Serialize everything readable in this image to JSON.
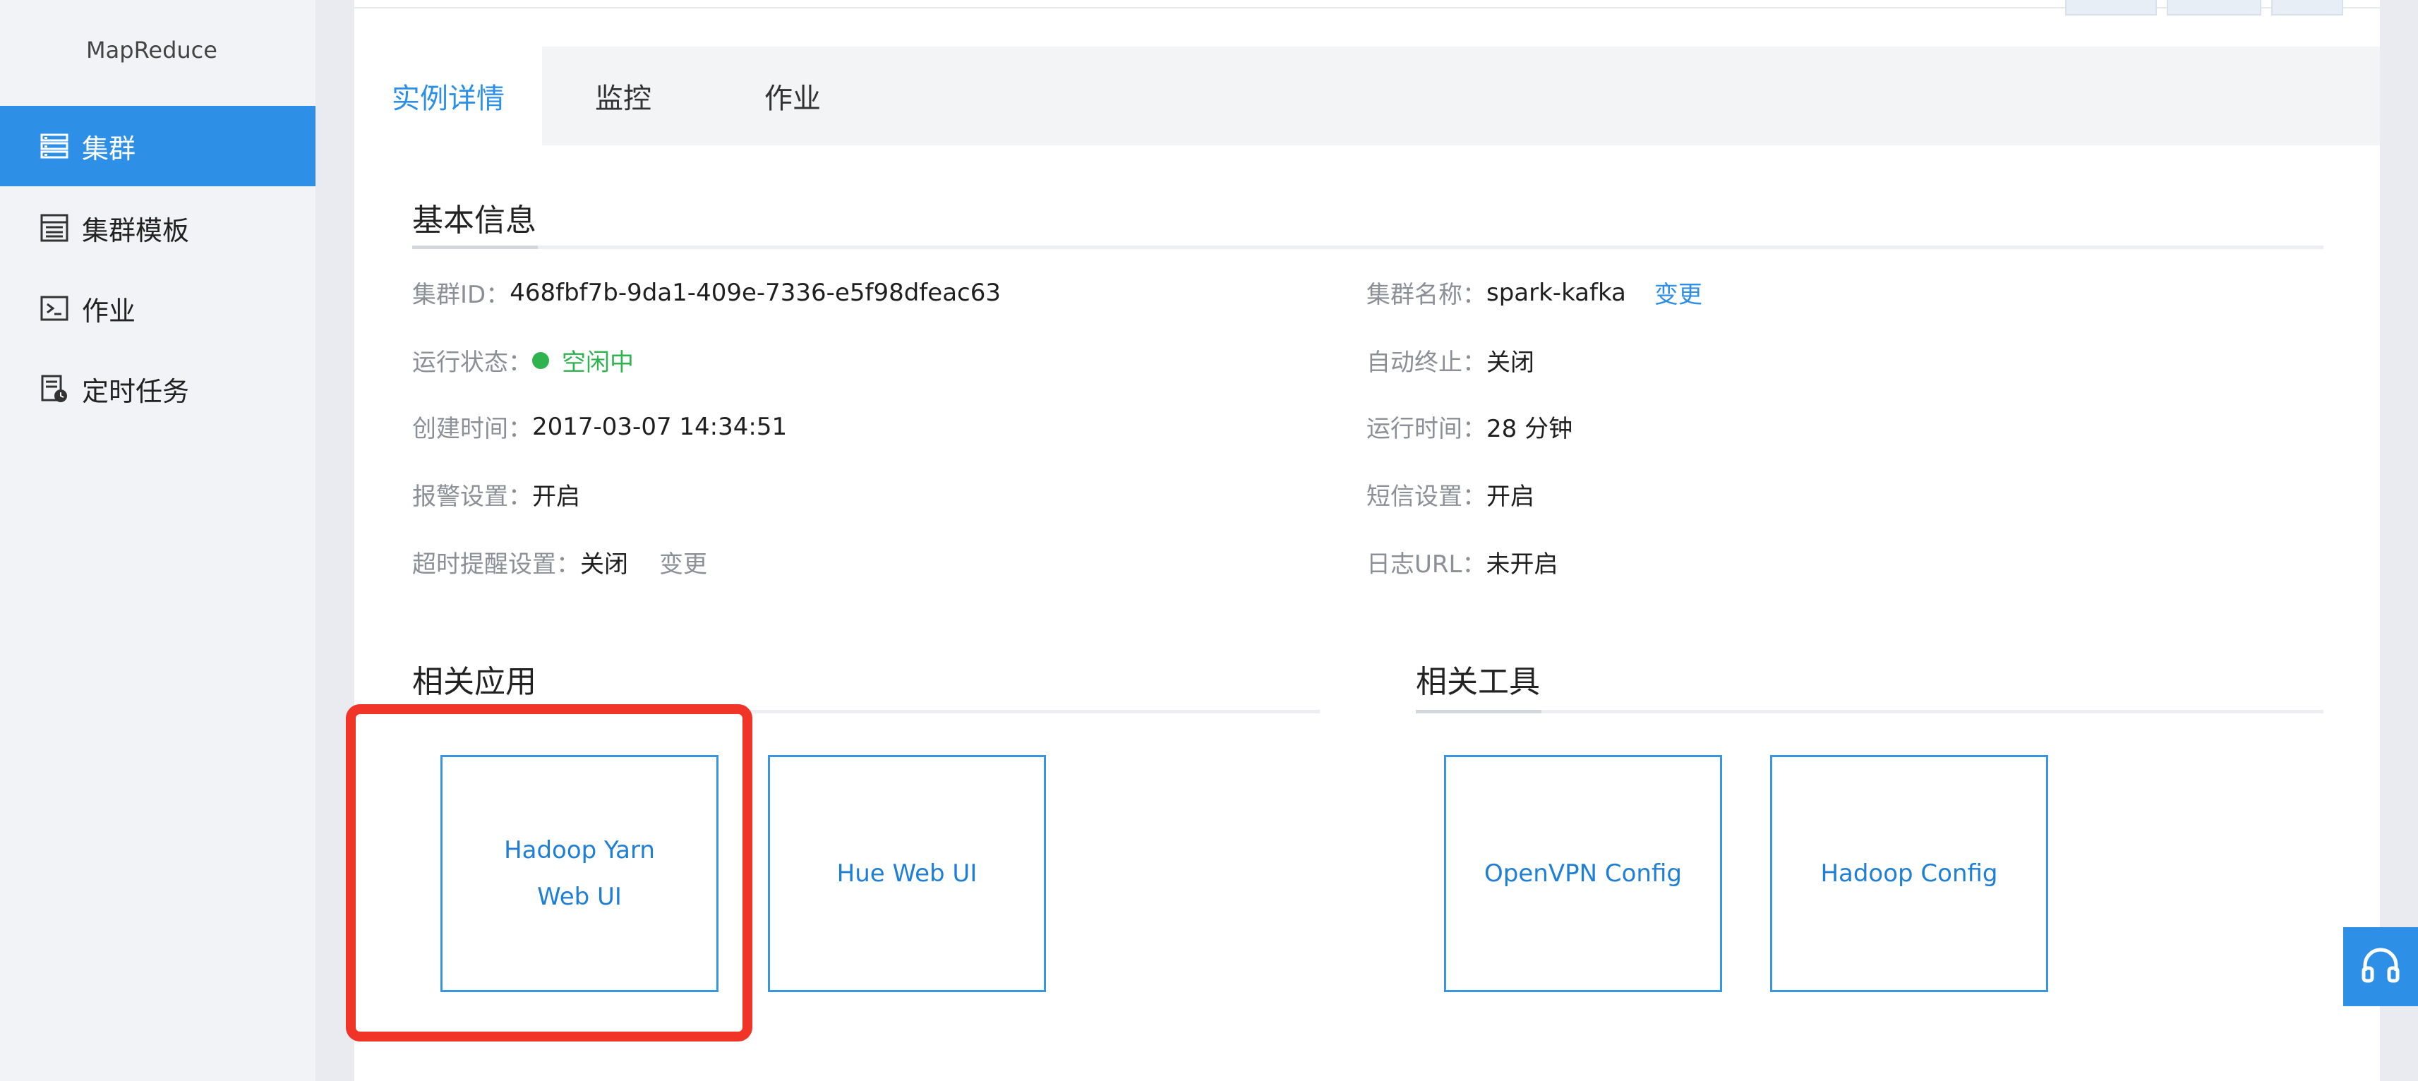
{
  "sidebar": {
    "title": "MapReduce",
    "items": [
      {
        "label": "集群",
        "icon": "server-list-icon",
        "active": true
      },
      {
        "label": "集群模板",
        "icon": "template-list-icon",
        "active": false
      },
      {
        "label": "作业",
        "icon": "terminal-icon",
        "active": false
      },
      {
        "label": "定时任务",
        "icon": "scheduled-task-icon",
        "active": false
      }
    ]
  },
  "tabs": [
    {
      "label": "实例详情",
      "active": true
    },
    {
      "label": "监控",
      "active": false
    },
    {
      "label": "作业",
      "active": false
    }
  ],
  "basic_info": {
    "title": "基本信息",
    "cluster_id": {
      "label": "集群ID：",
      "value": "468fbf7b-9da1-409e-7336-e5f98dfeac63"
    },
    "cluster_name": {
      "label": "集群名称：",
      "value": "spark-kafka",
      "action": "变更"
    },
    "run_status": {
      "label": "运行状态：",
      "value": "空闲中"
    },
    "auto_terminate": {
      "label": "自动终止：",
      "value": "关闭"
    },
    "created_time": {
      "label": "创建时间：",
      "value": "2017-03-07 14:34:51"
    },
    "run_time": {
      "label": "运行时间：",
      "value": "28 分钟"
    },
    "alarm_setting": {
      "label": "报警设置：",
      "value": "开启"
    },
    "sms_setting": {
      "label": "短信设置：",
      "value": "开启"
    },
    "timeout_reminder": {
      "label": "超时提醒设置：",
      "value": "关闭",
      "action": "变更"
    },
    "log_url": {
      "label": "日志URL：",
      "value": "未开启"
    }
  },
  "related_apps": {
    "title": "相关应用",
    "items": [
      {
        "line1": "Hadoop Yarn",
        "line2": "Web UI"
      },
      {
        "line1": "Hue Web UI",
        "line2": ""
      }
    ]
  },
  "related_tools": {
    "title": "相关工具",
    "items": [
      {
        "label": "OpenVPN Config"
      },
      {
        "label": "Hadoop Config"
      }
    ]
  },
  "colors": {
    "accent": "#2d8fe5",
    "status_green": "#2fb34f",
    "highlight_red": "#f03428"
  },
  "support_icon": "headset-icon"
}
